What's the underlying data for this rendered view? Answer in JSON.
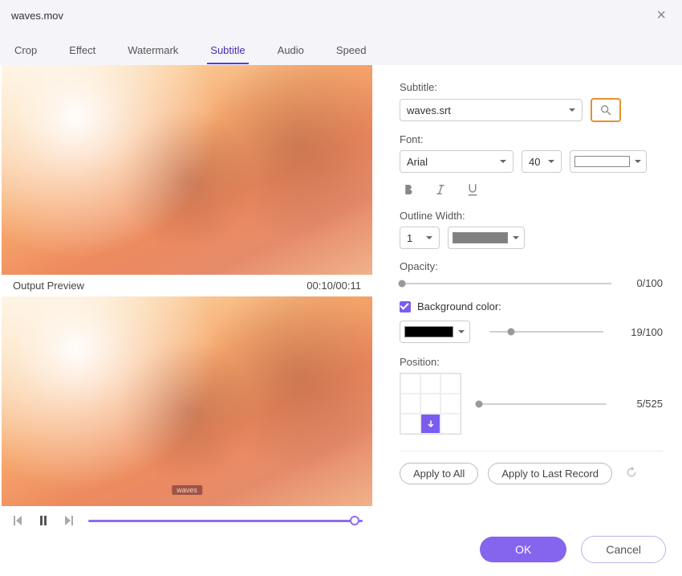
{
  "window": {
    "title": "waves.mov"
  },
  "tabs": {
    "items": [
      "Crop",
      "Effect",
      "Watermark",
      "Subtitle",
      "Audio",
      "Speed"
    ],
    "active_index": 3
  },
  "preview": {
    "label": "Output Preview",
    "time": "00:10/00:11",
    "subtitle_overlay": "waves"
  },
  "subtitle": {
    "label": "Subtitle:",
    "file": "waves.srt"
  },
  "font": {
    "label": "Font:",
    "family": "Arial",
    "size": "40"
  },
  "outline": {
    "label": "Outline Width:",
    "width": "1"
  },
  "opacity": {
    "label": "Opacity:",
    "display": "0/100",
    "value_pct": 0
  },
  "bgcolor": {
    "label": "Background color:",
    "display": "19/100",
    "value_pct": 19,
    "checked": true
  },
  "position": {
    "label": "Position:",
    "display": "5/525",
    "slider_pct": 1,
    "active_cell": 7
  },
  "apply": {
    "all": "Apply to All",
    "last": "Apply to Last Record"
  },
  "footer": {
    "ok": "OK",
    "cancel": "Cancel"
  }
}
